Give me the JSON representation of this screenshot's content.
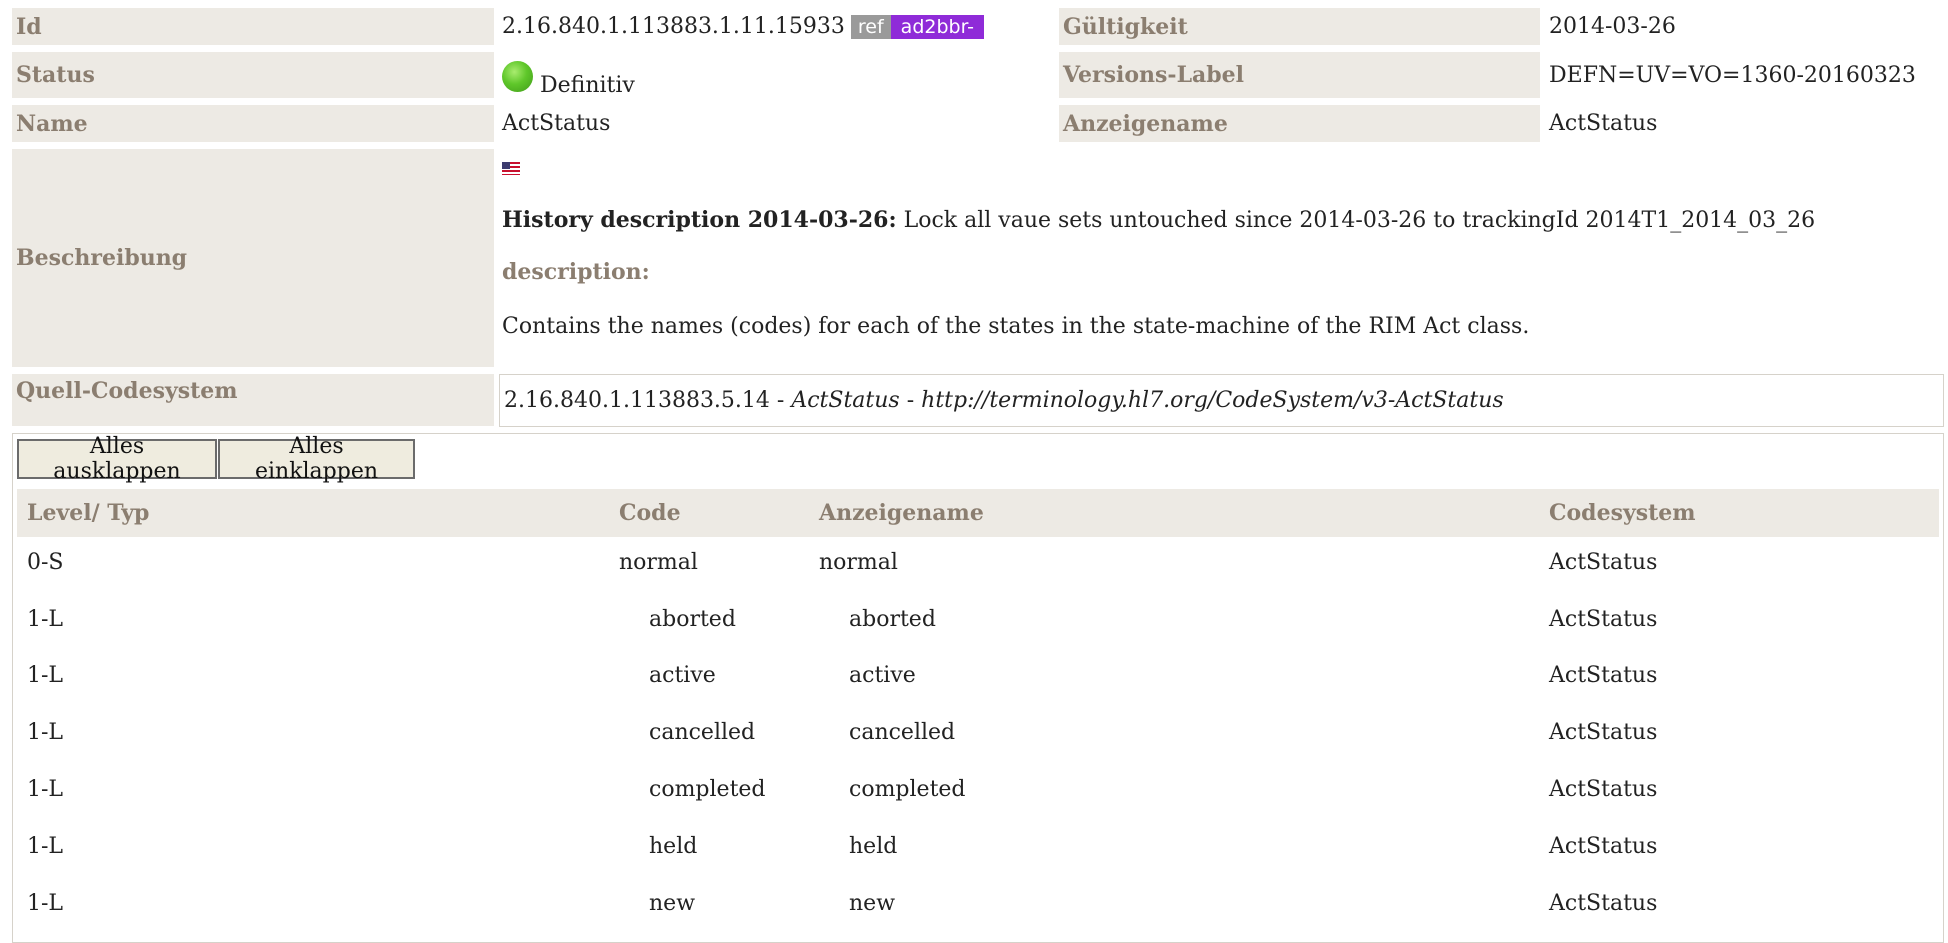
{
  "meta": {
    "id_label": "Id",
    "id_value": "2.16.840.1.113883.1.11.15933",
    "ref_badge": "ref",
    "id_badge": "ad2bbr-",
    "validity_label": "Gültigkeit",
    "validity_value": "2014-03-26",
    "status_label": "Status",
    "status_value": "Definitiv",
    "version_label": "Versions-Label",
    "version_value": "DEFN=UV=VO=1360-20160323",
    "name_label": "Name",
    "name_value": "ActStatus",
    "display_label": "Anzeigename",
    "display_value": "ActStatus",
    "description_label": "Beschreibung",
    "history_title": "History description 2014-03-26:",
    "history_text": " Lock all vaue sets untouched since 2014-03-26 to trackingId 2014T1_2014_03_26",
    "description_heading": "description:",
    "description_text": "Contains the names (codes) for each of the states in the state-machine of the RIM Act class.",
    "source_label": "Quell-Codesystem",
    "source_oid": "2.16.840.1.113883.5.14",
    "source_sep1": " - ",
    "source_name": "ActStatus",
    "source_sep2": " - ",
    "source_url": "http://terminology.hl7.org/CodeSystem/v3-ActStatus"
  },
  "toolbar": {
    "expand_all": "Alles ausklappen",
    "collapse_all": "Alles einklappen"
  },
  "table": {
    "headers": [
      "Level/ Typ",
      "Code",
      "Anzeigename",
      "Codesystem"
    ],
    "rows": [
      [
        "0-S",
        "normal",
        "normal",
        "ActStatus"
      ],
      [
        "1-L",
        "aborted",
        "aborted",
        "ActStatus"
      ],
      [
        "1-L",
        "active",
        "active",
        "ActStatus"
      ],
      [
        "1-L",
        "cancelled",
        "cancelled",
        "ActStatus"
      ],
      [
        "1-L",
        "completed",
        "completed",
        "ActStatus"
      ],
      [
        "1-L",
        "held",
        "held",
        "ActStatus"
      ],
      [
        "1-L",
        "new",
        "new",
        "ActStatus"
      ]
    ]
  },
  "colors": {
    "label_bg": "#edeae4",
    "label_text": "#8b7e70",
    "badge_ref": "#9a9a9a",
    "badge_id": "#8f2bd8",
    "status_active": "#5fc72a"
  },
  "icons": {
    "status": "green-circle-icon",
    "language": "us-flag-icon"
  }
}
